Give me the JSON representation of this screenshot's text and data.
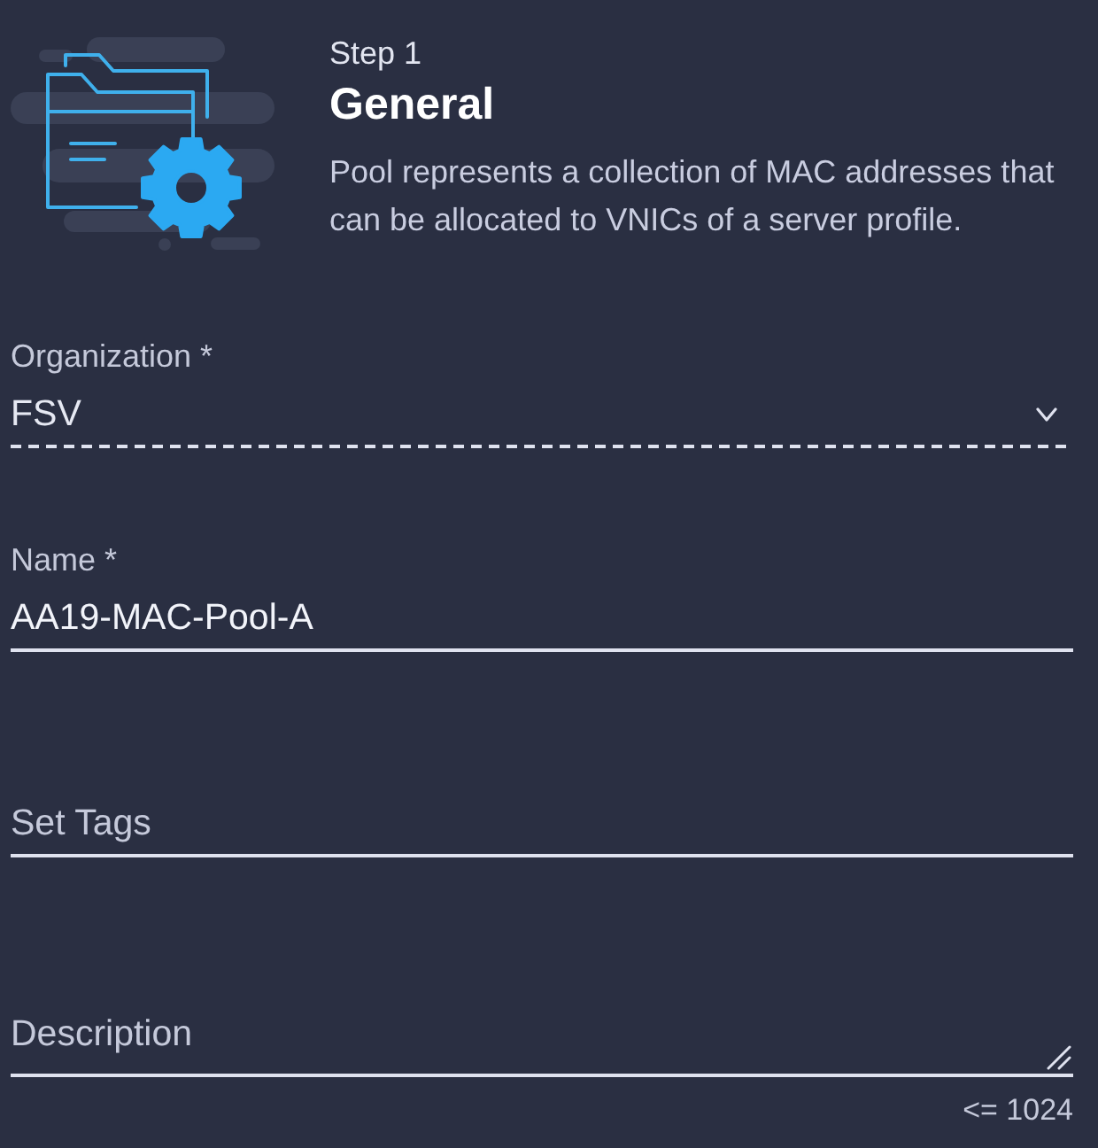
{
  "header": {
    "step": "Step 1",
    "title": "General",
    "description": "Pool represents a collection of MAC addresses that can be allocated to VNICs of a server profile."
  },
  "fields": [
    {
      "kind": "select",
      "label": "Organization *",
      "value": "FSV"
    },
    {
      "kind": "text",
      "label": "Name *",
      "value": "AA19-MAC-Pool-A"
    },
    {
      "kind": "text",
      "placeholder": "Set Tags"
    },
    {
      "kind": "textarea",
      "placeholder": "Description",
      "counter": "<= 1024"
    }
  ]
}
